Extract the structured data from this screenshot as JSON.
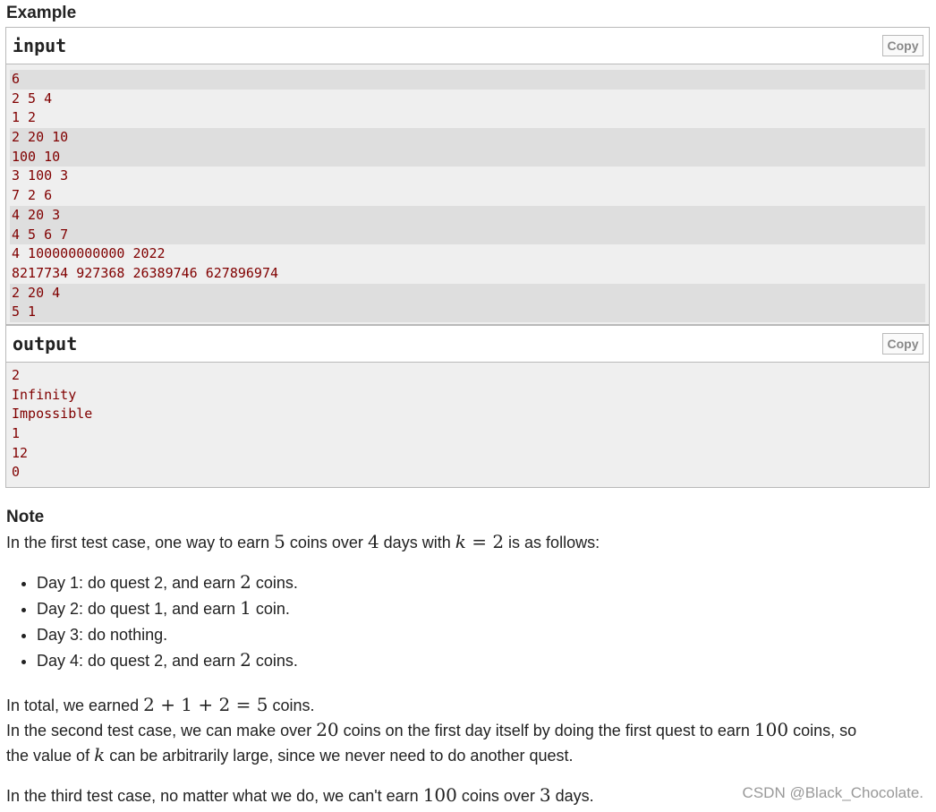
{
  "example": {
    "title": "Example",
    "copy_label": "Copy",
    "input": {
      "header": "input",
      "lines": [
        {
          "text": "6",
          "alt": true
        },
        {
          "text": "2 5 4",
          "alt": false
        },
        {
          "text": "1 2",
          "alt": false
        },
        {
          "text": "2 20 10",
          "alt": true
        },
        {
          "text": "100 10",
          "alt": true
        },
        {
          "text": "3 100 3",
          "alt": false
        },
        {
          "text": "7 2 6",
          "alt": false
        },
        {
          "text": "4 20 3",
          "alt": true
        },
        {
          "text": "4 5 6 7",
          "alt": true
        },
        {
          "text": "4 100000000000 2022",
          "alt": false
        },
        {
          "text": "8217734 927368 26389746 627896974",
          "alt": false
        },
        {
          "text": "2 20 4",
          "alt": true
        },
        {
          "text": "5 1",
          "alt": true
        }
      ]
    },
    "output": {
      "header": "output",
      "lines": [
        "2",
        "Infinity",
        "Impossible",
        "1",
        "12",
        "0"
      ]
    }
  },
  "note": {
    "title": "Note",
    "p1": {
      "a": "In the first test case, one way to earn ",
      "m1": "5",
      "b": " coins over ",
      "m2": "4",
      "c": " days with ",
      "mk": "k",
      "eq": " = 2",
      "d": " is as follows:"
    },
    "steps": [
      {
        "a": "Day 1: do quest 2, and earn ",
        "m": "2",
        "b": " coins."
      },
      {
        "a": "Day 2: do quest 1, and earn ",
        "m": "1",
        "b": " coin."
      },
      {
        "a": "Day 3: do nothing.",
        "m": "",
        "b": ""
      },
      {
        "a": "Day 4: do quest 2, and earn ",
        "m": "2",
        "b": " coins."
      }
    ],
    "p2": {
      "a": "In total, we earned ",
      "m": "2 + 1 + 2 = 5",
      "b": " coins."
    },
    "p3": {
      "a": "In the second test case, we can make over ",
      "m1": "20",
      "b": " coins on the first day itself by doing the first quest to earn ",
      "m2": "100",
      "c": " coins, so"
    },
    "p3b": {
      "a": "the value of ",
      "mk": "k",
      "b": " can be arbitrarily large, since we never need to do another quest."
    },
    "p4": {
      "a": "In the third test case, no matter what we do, we can't earn ",
      "m1": "100",
      "b": " coins over ",
      "m2": "3",
      "c": " days."
    }
  },
  "watermark": "CSDN @Black_Chocolate."
}
